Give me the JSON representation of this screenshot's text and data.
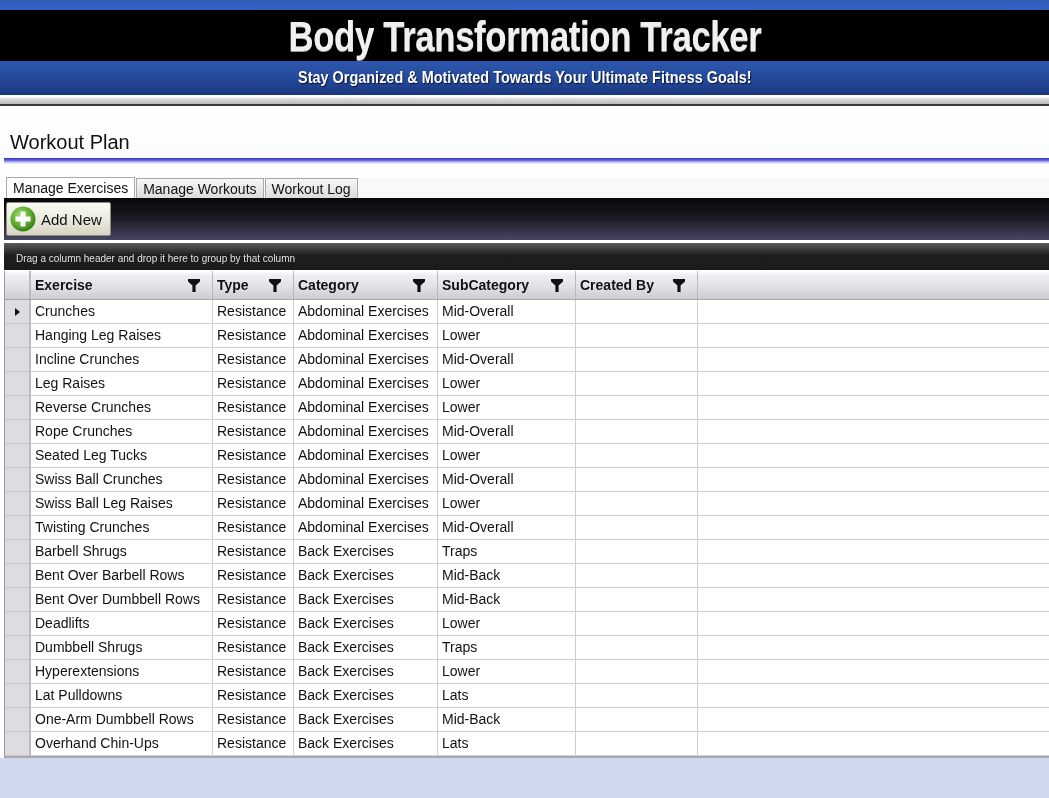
{
  "banner": {
    "title": "Body Transformation Tracker",
    "subtitle": "Stay Organized & Motivated Towards Your Ultimate Fitness Goals!"
  },
  "page": {
    "title": "Workout Plan"
  },
  "tabs": [
    {
      "label": "Manage Exercises",
      "selected": true
    },
    {
      "label": "Manage Workouts",
      "selected": false
    },
    {
      "label": "Workout Log",
      "selected": false
    }
  ],
  "toolbar": {
    "add_button": "Add New"
  },
  "grid": {
    "group_panel_hint": "Drag a column header and drop it here to group by that column",
    "columns": [
      {
        "label": "Exercise"
      },
      {
        "label": "Type"
      },
      {
        "label": "Category"
      },
      {
        "label": "SubCategory"
      },
      {
        "label": "Created By"
      }
    ],
    "rows": [
      {
        "current": true,
        "cells": [
          "Crunches",
          "Resistance",
          "Abdominal Exercises",
          "Mid-Overall"
        ]
      },
      {
        "current": false,
        "cells": [
          "Hanging Leg Raises",
          "Resistance",
          "Abdominal Exercises",
          "Lower"
        ]
      },
      {
        "current": false,
        "cells": [
          "Incline Crunches",
          "Resistance",
          "Abdominal Exercises",
          "Mid-Overall"
        ]
      },
      {
        "current": false,
        "cells": [
          "Leg Raises",
          "Resistance",
          "Abdominal Exercises",
          "Lower"
        ]
      },
      {
        "current": false,
        "cells": [
          "Reverse Crunches",
          "Resistance",
          "Abdominal Exercises",
          "Lower"
        ]
      },
      {
        "current": false,
        "cells": [
          "Rope Crunches",
          "Resistance",
          "Abdominal Exercises",
          "Mid-Overall"
        ]
      },
      {
        "current": false,
        "cells": [
          "Seated Leg Tucks",
          "Resistance",
          "Abdominal Exercises",
          "Lower"
        ]
      },
      {
        "current": false,
        "cells": [
          "Swiss Ball Crunches",
          "Resistance",
          "Abdominal Exercises",
          "Mid-Overall"
        ]
      },
      {
        "current": false,
        "cells": [
          "Swiss Ball Leg Raises",
          "Resistance",
          "Abdominal Exercises",
          "Lower"
        ]
      },
      {
        "current": false,
        "cells": [
          "Twisting Crunches",
          "Resistance",
          "Abdominal Exercises",
          "Mid-Overall"
        ]
      },
      {
        "current": false,
        "cells": [
          "Barbell Shrugs",
          "Resistance",
          "Back Exercises",
          "Traps"
        ]
      },
      {
        "current": false,
        "cells": [
          "Bent Over Barbell Rows",
          "Resistance",
          "Back Exercises",
          "Mid-Back"
        ]
      },
      {
        "current": false,
        "cells": [
          "Bent Over Dumbbell Rows",
          "Resistance",
          "Back Exercises",
          "Mid-Back"
        ]
      },
      {
        "current": false,
        "cells": [
          "Deadlifts",
          "Resistance",
          "Back Exercises",
          "Lower"
        ]
      },
      {
        "current": false,
        "cells": [
          "Dumbbell Shrugs",
          "Resistance",
          "Back Exercises",
          "Traps"
        ]
      },
      {
        "current": false,
        "cells": [
          "Hyperextensions",
          "Resistance",
          "Back Exercises",
          "Lower"
        ]
      },
      {
        "current": false,
        "cells": [
          "Lat Pulldowns",
          "Resistance",
          "Back Exercises",
          "Lats"
        ]
      },
      {
        "current": false,
        "cells": [
          "One-Arm Dumbbell Rows",
          "Resistance",
          "Back Exercises",
          "Mid-Back"
        ]
      },
      {
        "current": false,
        "cells": [
          "Overhand Chin-Ups",
          "Resistance",
          "Back Exercises",
          "Lats"
        ]
      }
    ]
  }
}
